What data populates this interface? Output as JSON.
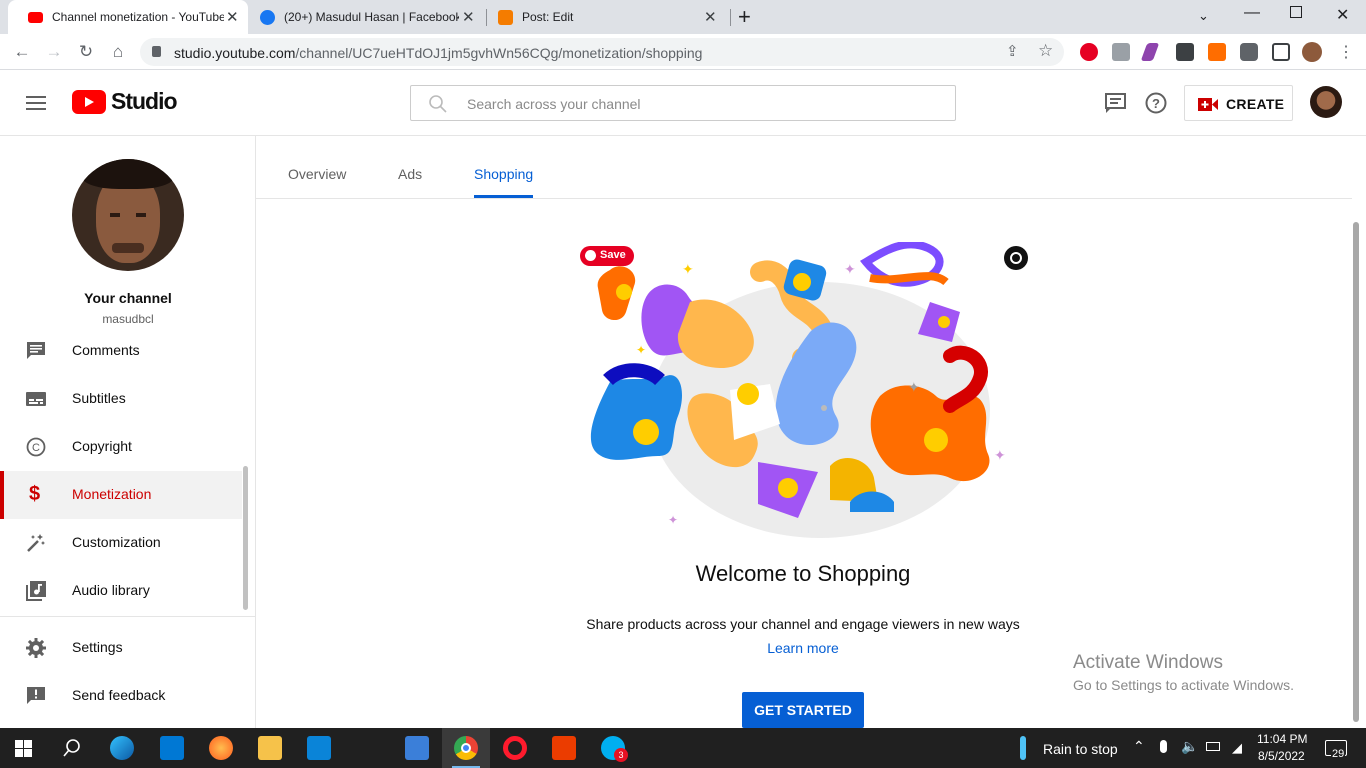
{
  "browser": {
    "tabs": [
      {
        "title": "Channel monetization - YouTube",
        "active": true
      },
      {
        "title": "(20+) Masudul Hasan | Facebook",
        "active": false
      },
      {
        "title": "Post: Edit",
        "active": false
      }
    ],
    "new_tab": "+",
    "url_host": "studio.youtube.com",
    "url_path": "/channel/UC7ueHTdOJ1jm5gvhWn56CQg/monetization/shopping"
  },
  "header": {
    "logo_text": "Studio",
    "search_placeholder": "Search across your channel",
    "create_label": "CREATE"
  },
  "sidebar": {
    "channel_label": "Your channel",
    "channel_handle": "masudbcl",
    "items": [
      {
        "label": "Comments",
        "icon": "comments-icon"
      },
      {
        "label": "Subtitles",
        "icon": "subtitles-icon"
      },
      {
        "label": "Copyright",
        "icon": "copyright-icon"
      },
      {
        "label": "Monetization",
        "icon": "dollar-icon",
        "active": true
      },
      {
        "label": "Customization",
        "icon": "magic-wand-icon"
      },
      {
        "label": "Audio library",
        "icon": "audio-library-icon"
      }
    ],
    "footer_items": [
      {
        "label": "Settings",
        "icon": "gear-icon"
      },
      {
        "label": "Send feedback",
        "icon": "feedback-icon"
      }
    ]
  },
  "main": {
    "tabs": [
      {
        "label": "Overview"
      },
      {
        "label": "Ads"
      },
      {
        "label": "Shopping",
        "active": true
      }
    ],
    "pinterest_save": "Save",
    "heading": "Welcome to Shopping",
    "description": "Share products across your channel and engage viewers in new ways",
    "learn_more": "Learn more",
    "cta": "GET STARTED"
  },
  "watermark": {
    "title": "Activate Windows",
    "subtitle": "Go to Settings to activate Windows."
  },
  "taskbar": {
    "weather": "Rain to stop",
    "time": "11:04 PM",
    "date": "8/5/2022",
    "notifications": "29",
    "skype_badge": "3"
  },
  "colors": {
    "accent_blue": "#065fd4",
    "youtube_red": "#ff0000",
    "active_red": "#cc0000"
  }
}
